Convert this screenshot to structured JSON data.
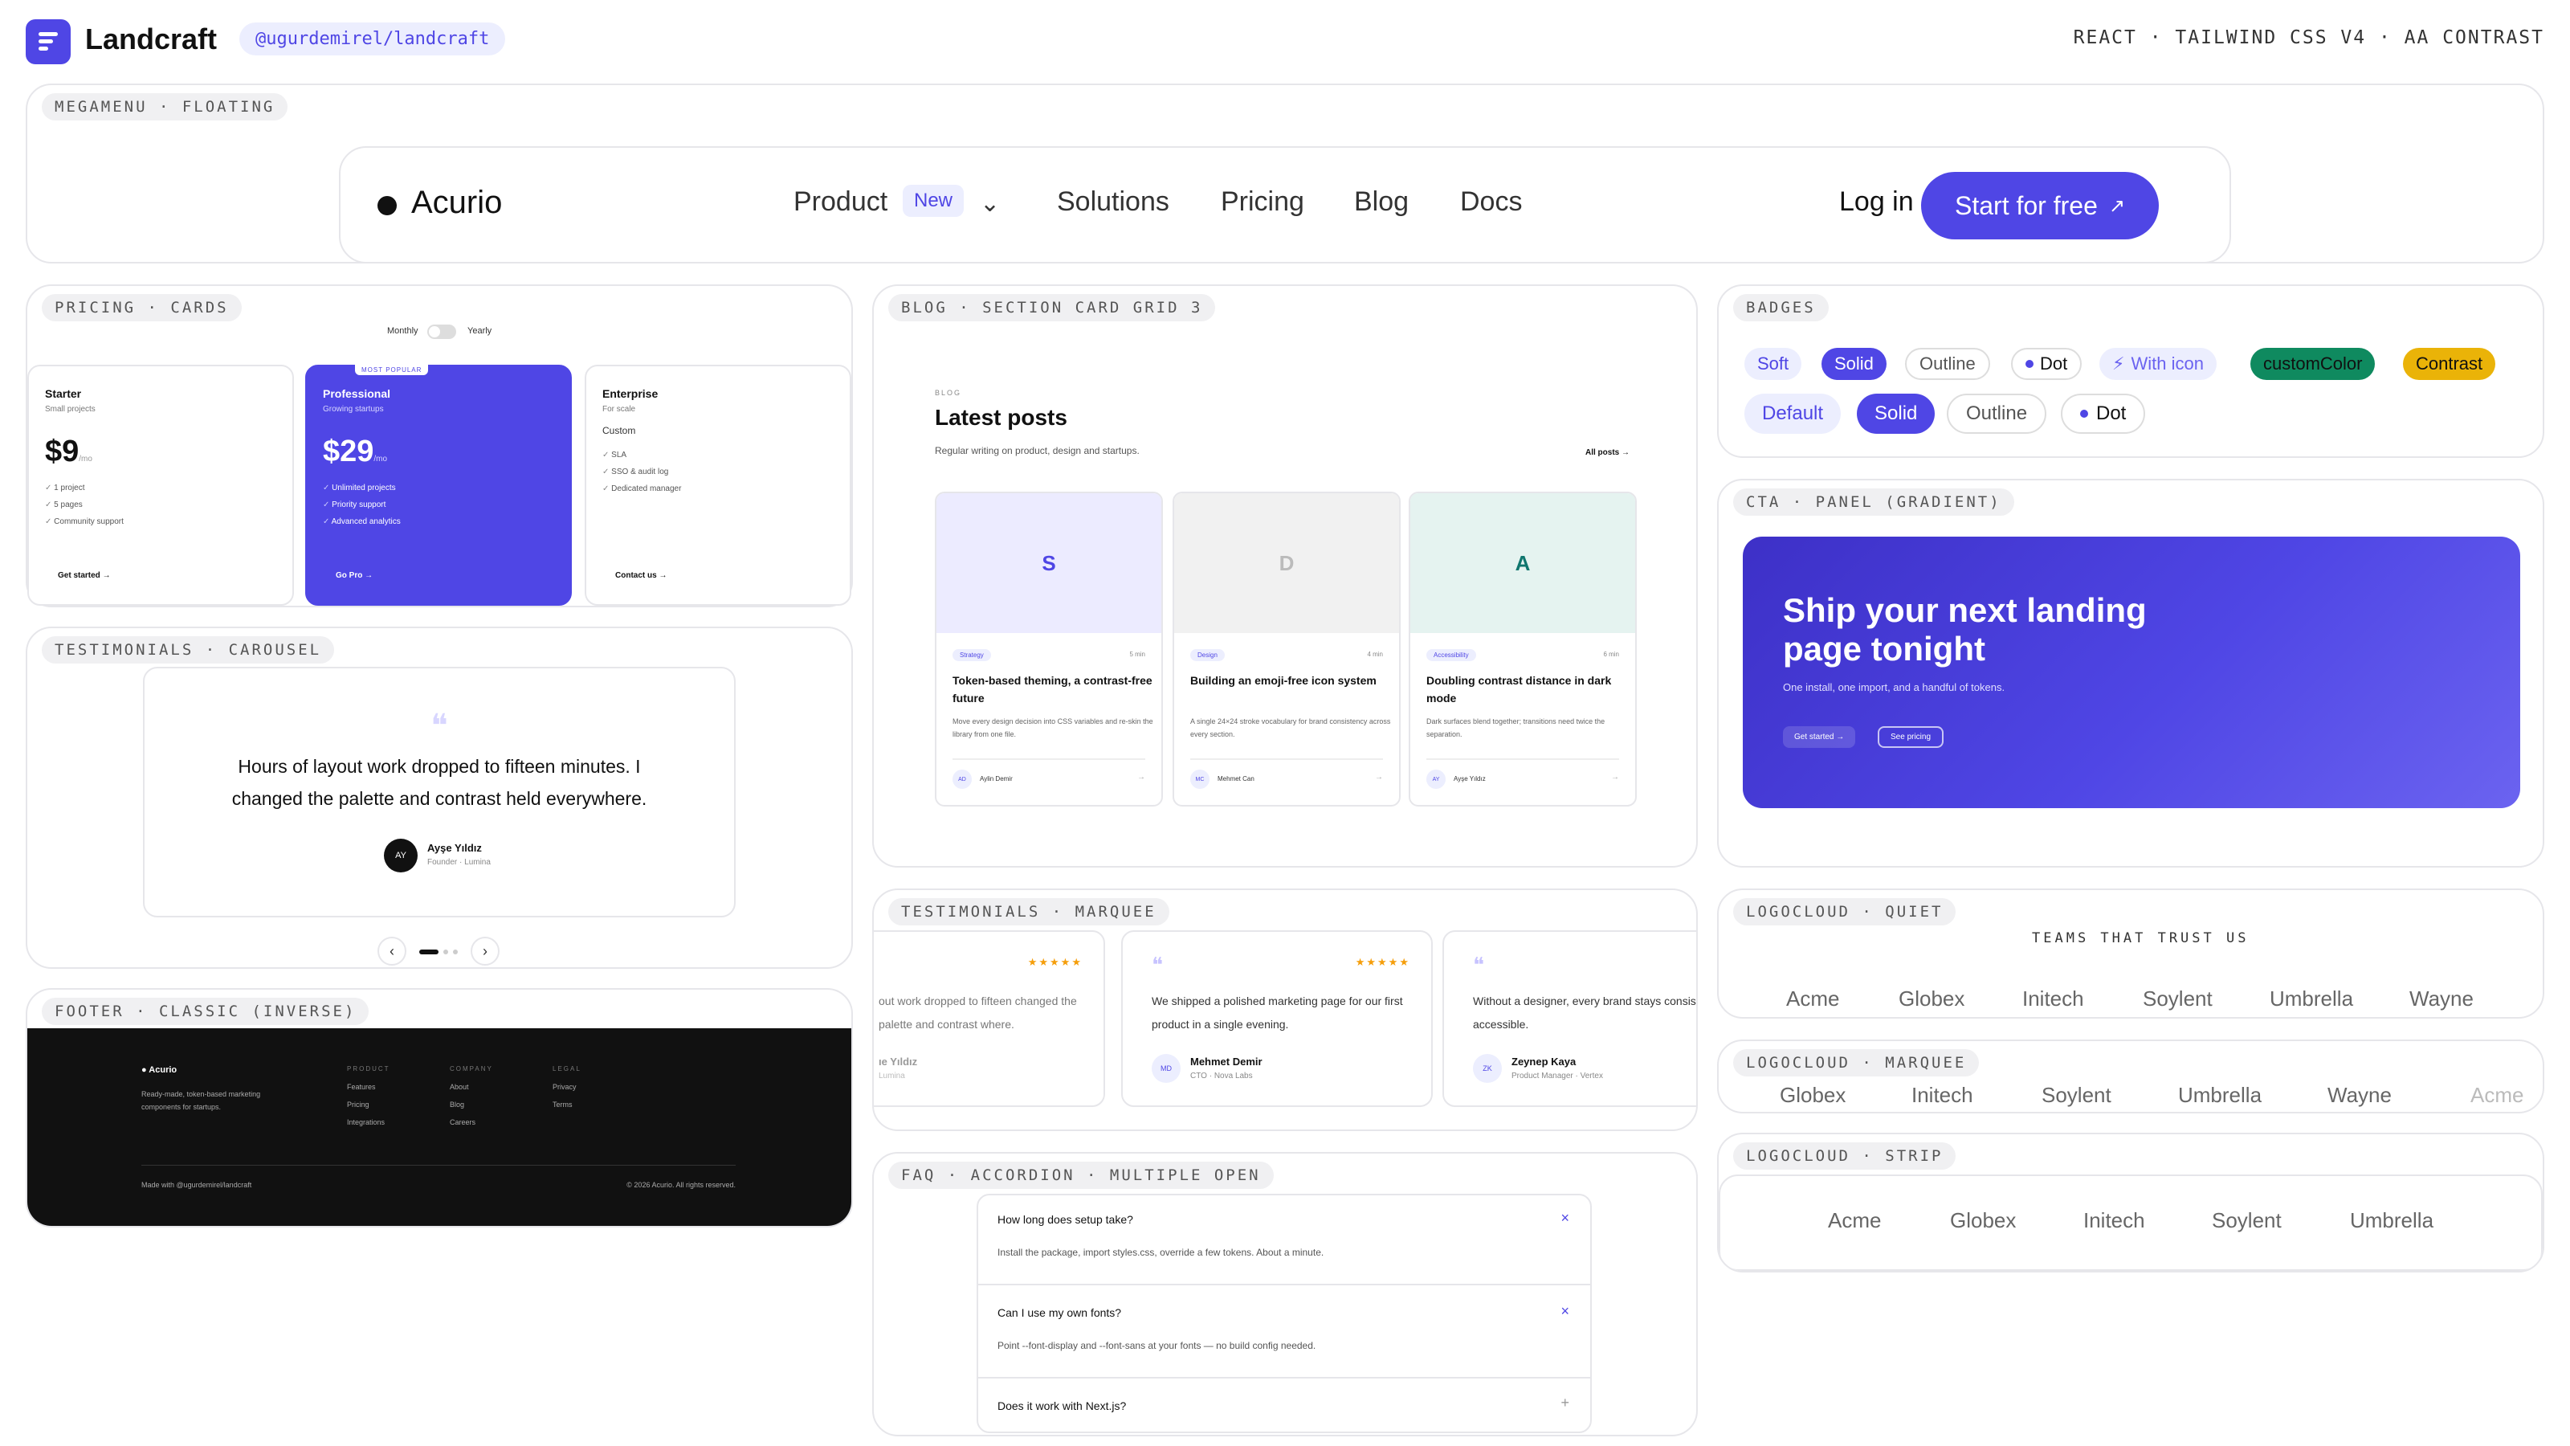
{
  "header": {
    "brand": "Landcraft",
    "repo": "@ugurdemirel/landcraft",
    "stack": "REACT · TAILWIND CSS V4 · AA CONTRAST"
  },
  "sections": {
    "megamenu": "MEGAMENU · FLOATING",
    "pricing": "PRICING · CARDS",
    "testimonials_carousel": "TESTIMONIALS · CAROUSEL",
    "footer": "FOOTER · CLASSIC (INVERSE)",
    "blog": "BLOG · SECTION CARD GRID 3",
    "testimonials_marquee": "TESTIMONIALS · MARQUEE",
    "faq": "FAQ · ACCORDION · MULTIPLE OPEN",
    "badges": "BADGES",
    "cta": "CTA · PANEL (GRADIENT)",
    "logocloud_quiet": "LOGOCLOUD · QUIET",
    "logocloud_marquee": "LOGOCLOUD · MARQUEE",
    "logocloud_strip": "LOGOCLOUD · STRIP"
  },
  "megamenu": {
    "logo": "Acurio",
    "items": [
      "Product",
      "Solutions",
      "Pricing",
      "Blog",
      "Docs"
    ],
    "new_badge": "New",
    "login": "Log in",
    "cta": "Start for free"
  },
  "pricing": {
    "toggle": [
      "Monthly",
      "Yearly"
    ],
    "popular": "MOST POPULAR",
    "plans": [
      {
        "name": "Starter",
        "sub": "Small projects",
        "price": "$9",
        "per": "/mo",
        "features": [
          "1 project",
          "5 pages",
          "Community support"
        ],
        "button": "Get started →"
      },
      {
        "name": "Professional",
        "sub": "Growing startups",
        "price": "$29",
        "per": "/mo",
        "features": [
          "Unlimited projects",
          "Priority support",
          "Advanced analytics"
        ],
        "button": "Go Pro →"
      },
      {
        "name": "Enterprise",
        "sub": "For scale",
        "price": "Custom",
        "features": [
          "SLA",
          "SSO & audit log",
          "Dedicated manager"
        ],
        "button": "Contact us →"
      }
    ]
  },
  "carousel": {
    "quote": "Hours of layout work dropped to fifteen minutes. I changed the palette and contrast held everywhere.",
    "initials": "AY",
    "name": "Ayşe Yıldız",
    "role": "Founder · Lumina",
    "prev": "‹",
    "next": "›"
  },
  "footer": {
    "brand": "Acurio",
    "tagline": "Ready-made, token-based marketing components for startups.",
    "columns": [
      {
        "title": "PRODUCT",
        "links": [
          "Features",
          "Pricing",
          "Integrations"
        ]
      },
      {
        "title": "COMPANY",
        "links": [
          "About",
          "Blog",
          "Careers"
        ]
      },
      {
        "title": "LEGAL",
        "links": [
          "Privacy",
          "Terms"
        ]
      }
    ],
    "made_with": "Made with @ugurdemirel/landcraft",
    "copyright": "© 2026 Acurio. All rights reserved."
  },
  "blog": {
    "eyebrow": "BLOG",
    "title": "Latest posts",
    "subtitle": "Regular writing on product, design and startups.",
    "all_posts": "All posts →",
    "posts": [
      {
        "letter": "S",
        "category": "Strategy",
        "minutes": "5 min",
        "title": "Token-based theming, a contrast-free future",
        "excerpt": "Move every design decision into CSS variables and re-skin the library from one file.",
        "initials": "AD",
        "author": "Aylin Demir"
      },
      {
        "letter": "D",
        "category": "Design",
        "minutes": "4 min",
        "title": "Building an emoji-free icon system",
        "excerpt": "A single 24×24 stroke vocabulary for brand consistency across every section.",
        "initials": "MC",
        "author": "Mehmet Can"
      },
      {
        "letter": "A",
        "category": "Accessibility",
        "minutes": "6 min",
        "title": "Doubling contrast distance in dark mode",
        "excerpt": "Dark surfaces blend together; transitions need twice the separation.",
        "initials": "AY",
        "author": "Ayşe Yıldız"
      }
    ]
  },
  "marquee": {
    "cards": [
      {
        "text": "out work dropped to fifteen changed the palette and contrast where.",
        "name": "ıe Yıldız",
        "role": "Lumina"
      },
      {
        "text": "We shipped a polished marketing page for our first product in a single evening.",
        "initials": "MD",
        "name": "Mehmet Demir",
        "role": "CTO · Nova Labs"
      },
      {
        "text": "Without a designer, every brand stays consistent and accessible.",
        "initials": "ZK",
        "name": "Zeynep Kaya",
        "role": "Product Manager · Vertex"
      }
    ],
    "stars": "★★★★★"
  },
  "faq": {
    "items": [
      {
        "q": "How long does setup take?",
        "a": "Install the package, import styles.css, override a few tokens. About a minute.",
        "icon": "×"
      },
      {
        "q": "Can I use my own fonts?",
        "a": "Point --font-display and --font-sans at your fonts — no build config needed.",
        "icon": "×"
      },
      {
        "q": "Does it work with Next.js?",
        "icon": "+"
      }
    ]
  },
  "badges": {
    "row1": [
      "Soft",
      "Solid",
      "Outline",
      "Dot",
      "With icon",
      "customColor",
      "Contrast"
    ],
    "row2": [
      "Default",
      "Solid",
      "Outline",
      "Dot"
    ]
  },
  "cta": {
    "title": "Ship your next landing page tonight",
    "subtitle": "One install, one import, and a handful of tokens.",
    "primary": "Get started →",
    "secondary": "See pricing"
  },
  "logos": {
    "quiet_title": "TEAMS THAT TRUST US",
    "quiet": [
      "Acme",
      "Globex",
      "Initech",
      "Soylent",
      "Umbrella",
      "Wayne"
    ],
    "marquee": [
      "Globex",
      "Initech",
      "Soylent",
      "Umbrella",
      "Wayne",
      "Acme"
    ],
    "strip": [
      "Acme",
      "Globex",
      "Initech",
      "Soylent",
      "Umbrella"
    ]
  },
  "colors": {
    "accent": "#4f46e5",
    "footer_bg": "#111111",
    "badge_green": "#0f8a5f",
    "badge_yellow": "#eab308"
  }
}
